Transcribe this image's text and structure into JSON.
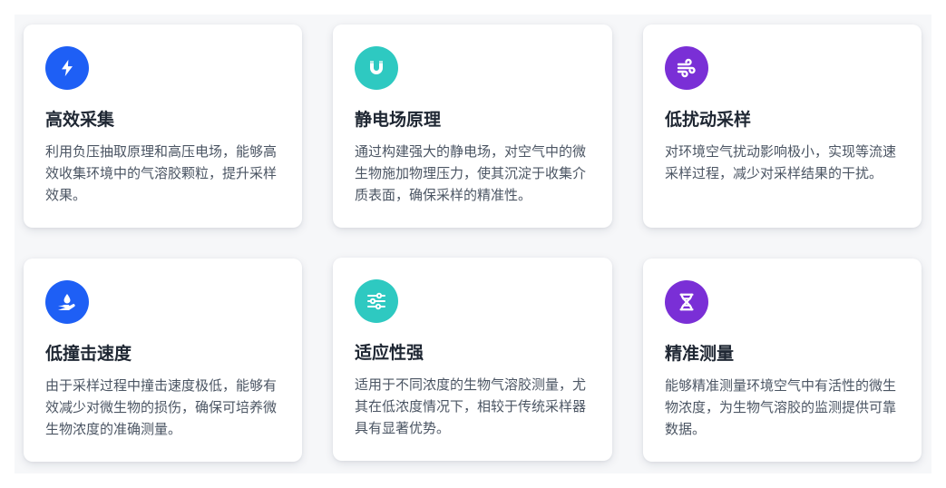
{
  "features": [
    {
      "title": "高效采集",
      "description": "利用负压抽取原理和高压电场，能够高效收集环境中的气溶胶颗粒，提升采样效果。",
      "icon": "lightning-icon",
      "icon_color": "#1e5ff5"
    },
    {
      "title": "静电场原理",
      "description": "通过构建强大的静电场，对空气中的微生物施加物理压力，使其沉淀于收集介质表面，确保采样的精准性。",
      "icon": "magnet-icon",
      "icon_color": "#2ec9c1"
    },
    {
      "title": "低扰动采样",
      "description": "对环境空气扰动影响极小，实现等流速采样过程，减少对采样结果的干扰。",
      "icon": "wind-icon",
      "icon_color": "#7a2fd6"
    },
    {
      "title": "低撞击速度",
      "description": "由于采样过程中撞击速度极低，能够有效减少对微生物的损伤，确保可培养微生物浓度的准确测量。",
      "icon": "hand-droplet-icon",
      "icon_color": "#1e5ff5"
    },
    {
      "title": "适应性强",
      "description": "适用于不同浓度的生物气溶胶测量，尤其在低浓度情况下，相较于传统采样器具有显著优势。",
      "icon": "sliders-icon",
      "icon_color": "#2ec9c1"
    },
    {
      "title": "精准测量",
      "description": "能够精准测量环境空气中有活性的微生物浓度，为生物气溶胶的监测提供可靠数据。",
      "icon": "dna-icon",
      "icon_color": "#7a2fd6"
    }
  ]
}
